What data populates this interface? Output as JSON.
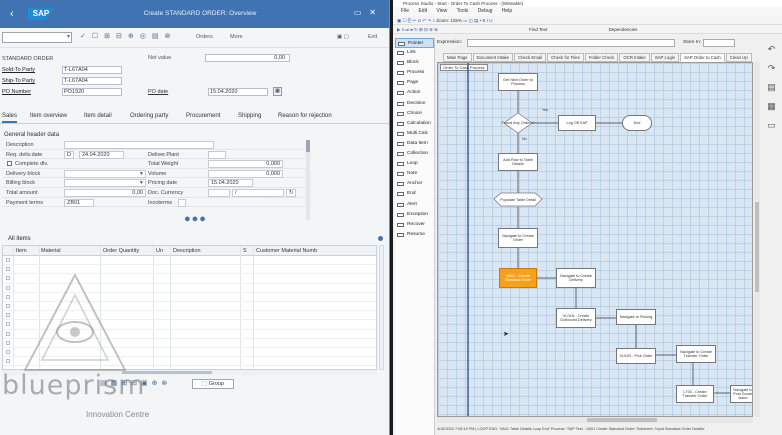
{
  "sap": {
    "title": "Create STANDARD ORDER: Overview",
    "logo": "SAP",
    "toolbar": {
      "orders_label": "Orders",
      "more_label": "More",
      "exit_label": "Exit"
    },
    "header": {
      "order_type": "STANDARD ORDER",
      "sold_to_label": "Sold-To Party",
      "sold_to_value": "T-L67A04",
      "ship_to_label": "Ship-To Party",
      "ship_to_value": "T-L67A04",
      "po_number_label": "PO Number",
      "po_number_value": "PO1920",
      "net_value_label": "Net value",
      "net_value": "0,00",
      "po_date_label": "PO date",
      "po_date_value": "15.04.2020"
    },
    "tabs": [
      "Sales",
      "Item overview",
      "Item detail",
      "Ordering party",
      "Procurement",
      "Shipping",
      "Reason for rejection"
    ],
    "general": {
      "title": "General header data",
      "description_label": "Description",
      "req_deliv_label": "Req. deliv.date",
      "req_deliv_prefix": "D",
      "req_deliv_value": "24.04.2020",
      "deliver_plant_label": "Deliver.Plant",
      "complete_dlv_label": "Complete dlv.",
      "total_weight_label": "Total Weight",
      "total_weight_value": "0,000",
      "delivery_block_label": "Delivery block",
      "volume_label": "Volume",
      "volume_value": "0,000",
      "billing_block_label": "Billing block",
      "pricing_date_label": "Pricing date",
      "pricing_date_value": "15.04.2020",
      "total_amount_label": "Total amount",
      "total_amount_value": "0,00",
      "doc_currency_label": "Doc. Currency",
      "payment_terms_label": "Payment terms",
      "payment_terms_value": "ZB01",
      "incoterms_label": "Incoterms"
    },
    "items": {
      "title": "All items",
      "columns": [
        "Item",
        "Material",
        "Order Quantity",
        "Un",
        "Description",
        "S",
        "Customer Material Numb"
      ]
    },
    "group_button": "Group",
    "watermark": {
      "brand": "blueprism",
      "sub": "Innovation Centre"
    }
  },
  "ps": {
    "title": "Process Studio - Start - Order To Cash Process - [Writeable]",
    "menu": [
      "File",
      "Edit",
      "View",
      "Tools",
      "Debug",
      "Help"
    ],
    "toolbar1": "Zoom: 125%",
    "toolbar2_find": "Find Text",
    "toolbar2_dep": "Dependencies",
    "expression_label": "Expression:",
    "store_in_label": "Store In:",
    "palette": [
      "Pointer",
      "Link",
      "Block",
      "Process",
      "Page",
      "Action",
      "Decision",
      "Choice",
      "Calculation",
      "Multi Calc",
      "Data Item",
      "Collection",
      "Loop",
      "Note",
      "Anchor",
      "End",
      "Alert",
      "Exception",
      "Recover",
      "Resume"
    ],
    "page_tabs": [
      "Main Page",
      "Document Intake",
      "Check Email",
      "Check for Files",
      "Folder Check",
      "OCR Intake",
      "SAP Login",
      "SAP Order to Cash",
      "Clean Up"
    ],
    "lane_label": "Order To Cash Process",
    "nodes": {
      "get_next": "Get Next Order to Process",
      "found_any": "Found Any Orders?",
      "log_off": "Log Off SAP",
      "end": "End",
      "yes": "Yes",
      "no": "No",
      "add_row": "Add Row to Table Details",
      "populate": "Populate Table Detail",
      "nav_create_order": "Navigate to Create Order",
      "va01": "VA01 - Create Standard Order",
      "nav_create_delivery": "Navigate to Create Delivery",
      "vl01n": "VL01N - Create Outbound Delivery",
      "nav_picking": "Navigate to Picking",
      "vl02n": "VL02N - Pick Order",
      "nav_transfer": "Navigate to Create Transfer Order",
      "lt03": "LT03 - Create Transfer Order",
      "nav_post": "Navigate to Post Goods Issue"
    },
    "status": "4/15/2020 7:05:14 PM | LOOP END: 'VA01 Table Details Loop End' Process: 'SAP Test - VA01 Create Standard Order' Subsheet: 'Input Standard Order Details'"
  }
}
